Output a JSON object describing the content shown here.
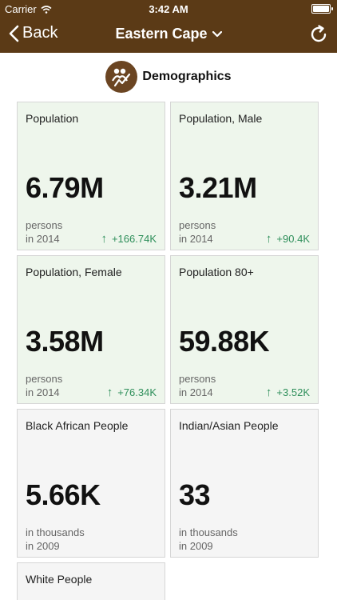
{
  "status_bar": {
    "carrier": "Carrier",
    "time": "3:42 AM"
  },
  "nav": {
    "back_label": "Back",
    "title": "Eastern Cape",
    "accent": "#5b3a16"
  },
  "section": {
    "label": "Demographics",
    "icon": "demographics-people-icon"
  },
  "cards": [
    {
      "title": "Population",
      "value": "6.79M",
      "unit": "persons",
      "year": "in 2014",
      "change": "+166.74K",
      "style": "green"
    },
    {
      "title": "Population, Male",
      "value": "3.21M",
      "unit": "persons",
      "year": "in 2014",
      "change": "+90.4K",
      "style": "green"
    },
    {
      "title": "Population, Female",
      "value": "3.58M",
      "unit": "persons",
      "year": "in 2014",
      "change": "+76.34K",
      "style": "green"
    },
    {
      "title": "Population 80+",
      "value": "59.88K",
      "unit": "persons",
      "year": "in 2014",
      "change": "+3.52K",
      "style": "green"
    },
    {
      "title": "Black African People",
      "value": "5.66K",
      "unit": "in thousands",
      "year": "in 2009",
      "style": "gray"
    },
    {
      "title": "Indian/Asian People",
      "value": "33",
      "unit": "in thousands",
      "year": "in 2009",
      "style": "gray"
    },
    {
      "title": "White People",
      "style": "gray"
    }
  ]
}
